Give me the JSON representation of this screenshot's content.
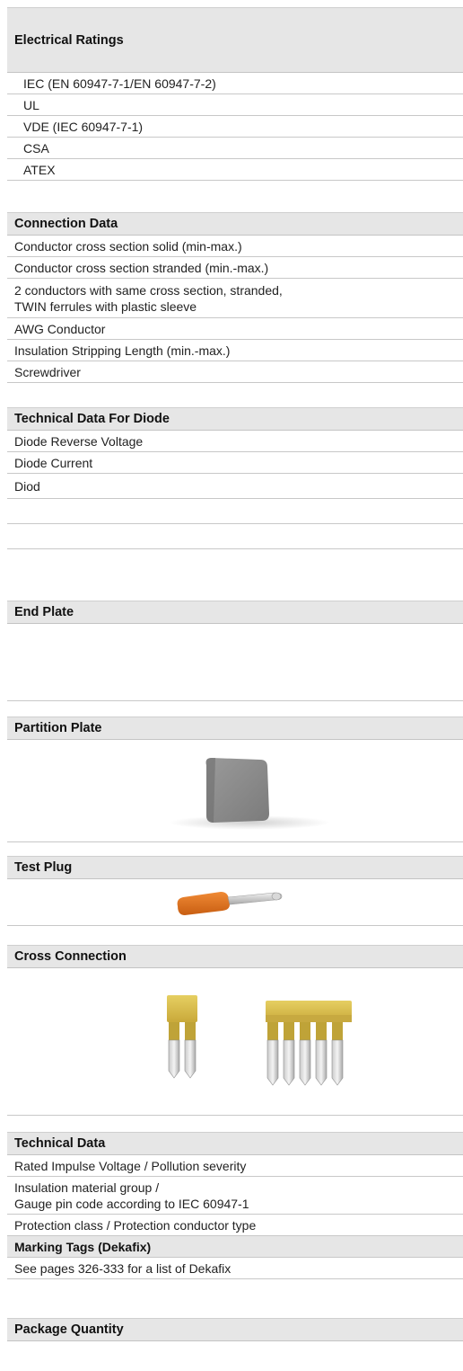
{
  "electrical_ratings": {
    "title": "Electrical Ratings",
    "items": [
      "IEC (EN 60947-7-1/EN 60947-7-2)",
      "UL",
      "VDE (IEC 60947-7-1)",
      "CSA",
      "ATEX"
    ]
  },
  "connection_data": {
    "title": "Connection Data",
    "items": [
      "Conductor cross section solid (min-max.)",
      "Conductor cross section stranded (min.-max.)",
      "2 conductors with same cross section, stranded,",
      "TWIN ferrules with plastic sleeve",
      "AWG Conductor",
      "Insulation Stripping Length (min.-max.)",
      "Screwdriver"
    ]
  },
  "diode_data": {
    "title": "Technical Data For Diode",
    "items": [
      "Diode  Reverse Voltage",
      "Diode  Current",
      "Diod"
    ]
  },
  "end_plate": {
    "title": "End Plate"
  },
  "partition_plate": {
    "title": "Partition Plate"
  },
  "test_plug": {
    "title": "Test Plug"
  },
  "cross_connection": {
    "title": "Cross Connection"
  },
  "technical_data": {
    "title": "Technical Data",
    "items": [
      "Rated Impulse Voltage / Pollution severity",
      "Insulation material group /",
      "Gauge pin code according to IEC 60947-1",
      "Protection class / Protection conductor type"
    ]
  },
  "marking_tags": {
    "title": "Marking Tags (Dekafix)",
    "note": "See pages 326-333 for a list of Dekafix"
  },
  "package_quantity": {
    "title": "Package Quantity"
  },
  "colors": {
    "header_bg": "#e6e6e6",
    "plate_gray": "#8a8a8a",
    "plug_orange": "#e0741f",
    "cross_yellow": "#dcc24a"
  }
}
